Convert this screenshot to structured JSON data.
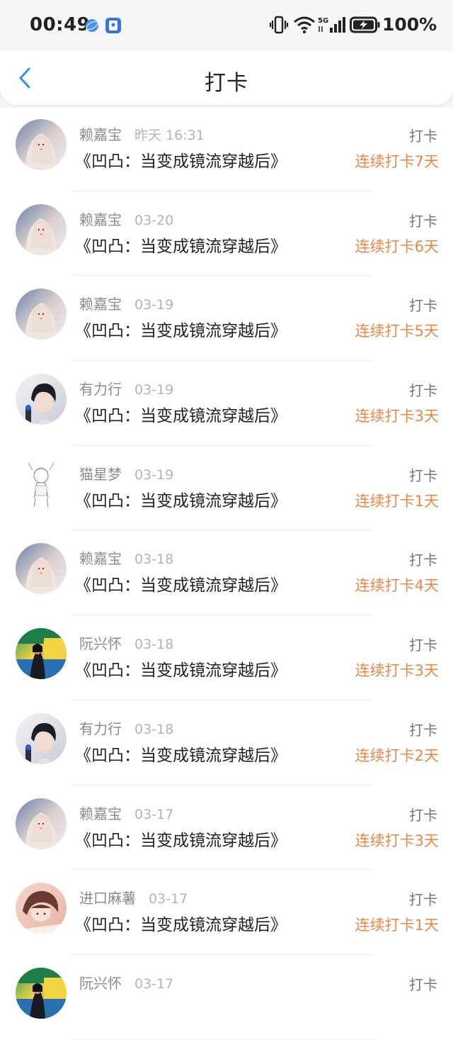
{
  "status_bar": {
    "time": "00:49",
    "battery": "100%",
    "network": "5G"
  },
  "header": {
    "title": "打卡"
  },
  "colors": {
    "accent_orange": "#e8874a",
    "back_blue": "#3a8ee6"
  },
  "records": [
    {
      "user": "赖嘉宝",
      "date": "昨天 16:31",
      "book": "《凹凸：当变成镜流穿越后》",
      "action": "打卡",
      "streak": "连续打卡7天",
      "avatar": "avatar-pale-girl"
    },
    {
      "user": "赖嘉宝",
      "date": "03-20",
      "book": "《凹凸：当变成镜流穿越后》",
      "action": "打卡",
      "streak": "连续打卡6天",
      "avatar": "avatar-pale-girl"
    },
    {
      "user": "赖嘉宝",
      "date": "03-19",
      "book": "《凹凸：当变成镜流穿越后》",
      "action": "打卡",
      "streak": "连续打卡5天",
      "avatar": "avatar-pale-girl"
    },
    {
      "user": "有力行",
      "date": "03-19",
      "book": "《凹凸：当变成镜流穿越后》",
      "action": "打卡",
      "streak": "连续打卡3天",
      "avatar": "avatar-dark-hair-boy"
    },
    {
      "user": "猫星梦",
      "date": "03-19",
      "book": "《凹凸：当变成镜流穿越后》",
      "action": "打卡",
      "streak": "连续打卡1天",
      "avatar": "avatar-sketch"
    },
    {
      "user": "赖嘉宝",
      "date": "03-18",
      "book": "《凹凸：当变成镜流穿越后》",
      "action": "打卡",
      "streak": "连续打卡4天",
      "avatar": "avatar-pale-girl"
    },
    {
      "user": "阮兴怀",
      "date": "03-18",
      "book": "《凹凸：当变成镜流穿越后》",
      "action": "打卡",
      "streak": "连续打卡3天",
      "avatar": "avatar-colorful-scene"
    },
    {
      "user": "有力行",
      "date": "03-18",
      "book": "《凹凸：当变成镜流穿越后》",
      "action": "打卡",
      "streak": "连续打卡2天",
      "avatar": "avatar-dark-hair-boy"
    },
    {
      "user": "赖嘉宝",
      "date": "03-17",
      "book": "《凹凸：当变成镜流穿越后》",
      "action": "打卡",
      "streak": "连续打卡3天",
      "avatar": "avatar-pale-girl"
    },
    {
      "user": "进口麻薯",
      "date": "03-17",
      "book": "《凹凸：当变成镜流穿越后》",
      "action": "打卡",
      "streak": "连续打卡1天",
      "avatar": "avatar-pink-anime"
    },
    {
      "user": "阮兴怀",
      "date": "03-17",
      "book": "",
      "action": "打卡",
      "streak": "",
      "avatar": "avatar-colorful-scene"
    }
  ]
}
